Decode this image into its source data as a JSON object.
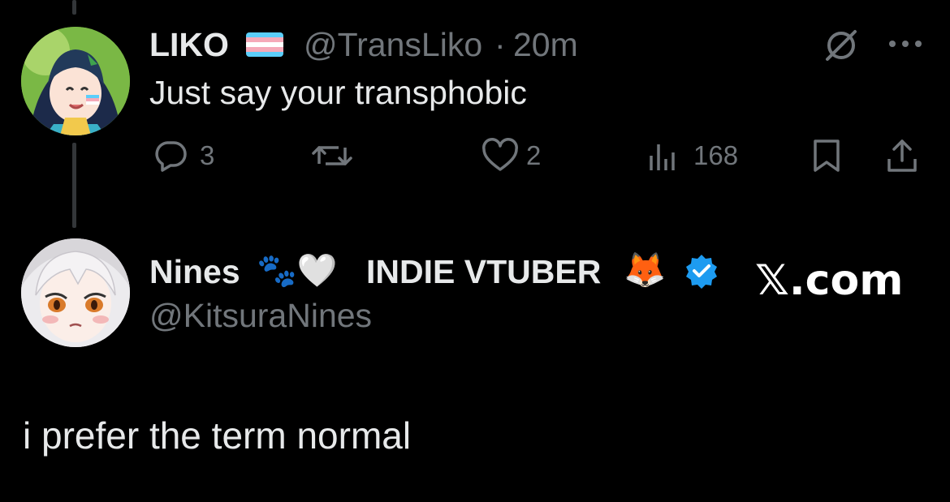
{
  "tweet": {
    "display_name": "LIKO",
    "handle": "@TransLiko",
    "separator": "·",
    "time": "20m",
    "text": "Just say your transphobic",
    "actions": {
      "replies": "3",
      "retweets": "",
      "likes": "2",
      "views": "168"
    },
    "icons": [
      "grok-icon",
      "more-icon",
      "reply-icon",
      "retweet-icon",
      "like-icon",
      "views-icon",
      "bookmark-icon",
      "share-icon"
    ]
  },
  "reply": {
    "display_name": "Nines",
    "badges": "🐾🤍",
    "title": "INDIE VTUBER",
    "emoji": "🦊",
    "verified": true,
    "handle": "@KitsuraNines",
    "text": "i prefer the term normal"
  },
  "watermark": "𝕏.com",
  "colors": {
    "background": "#000000",
    "text": "#e7e9ea",
    "muted": "#71767b",
    "verified": "#1d9bf0",
    "trans_blue": "#5bcefa",
    "trans_pink": "#f5a9b8"
  }
}
